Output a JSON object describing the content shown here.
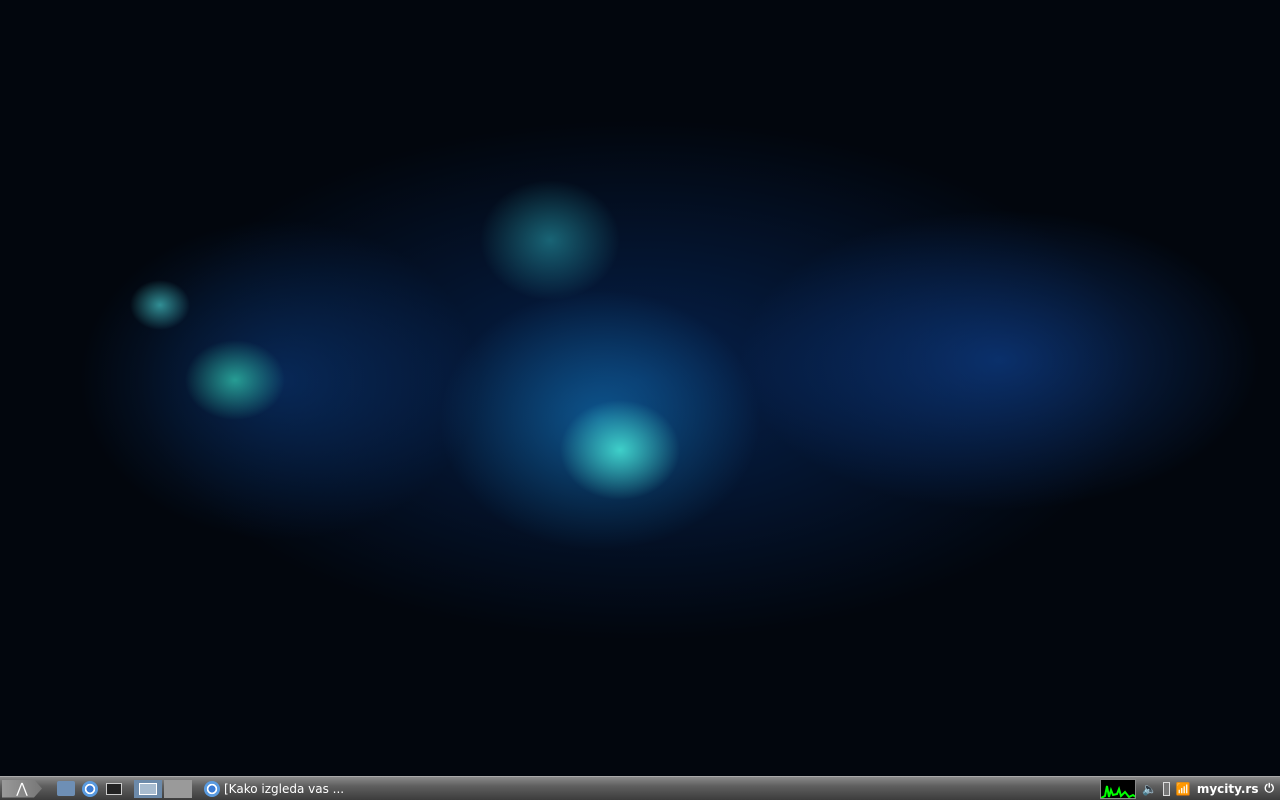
{
  "taskbar": {
    "task_title": "[Kako izgleda vas ...",
    "clock": "mycity.rs"
  },
  "colors": {
    "panel": "#5e5e5e",
    "cpu_graph": "#00ff00"
  }
}
